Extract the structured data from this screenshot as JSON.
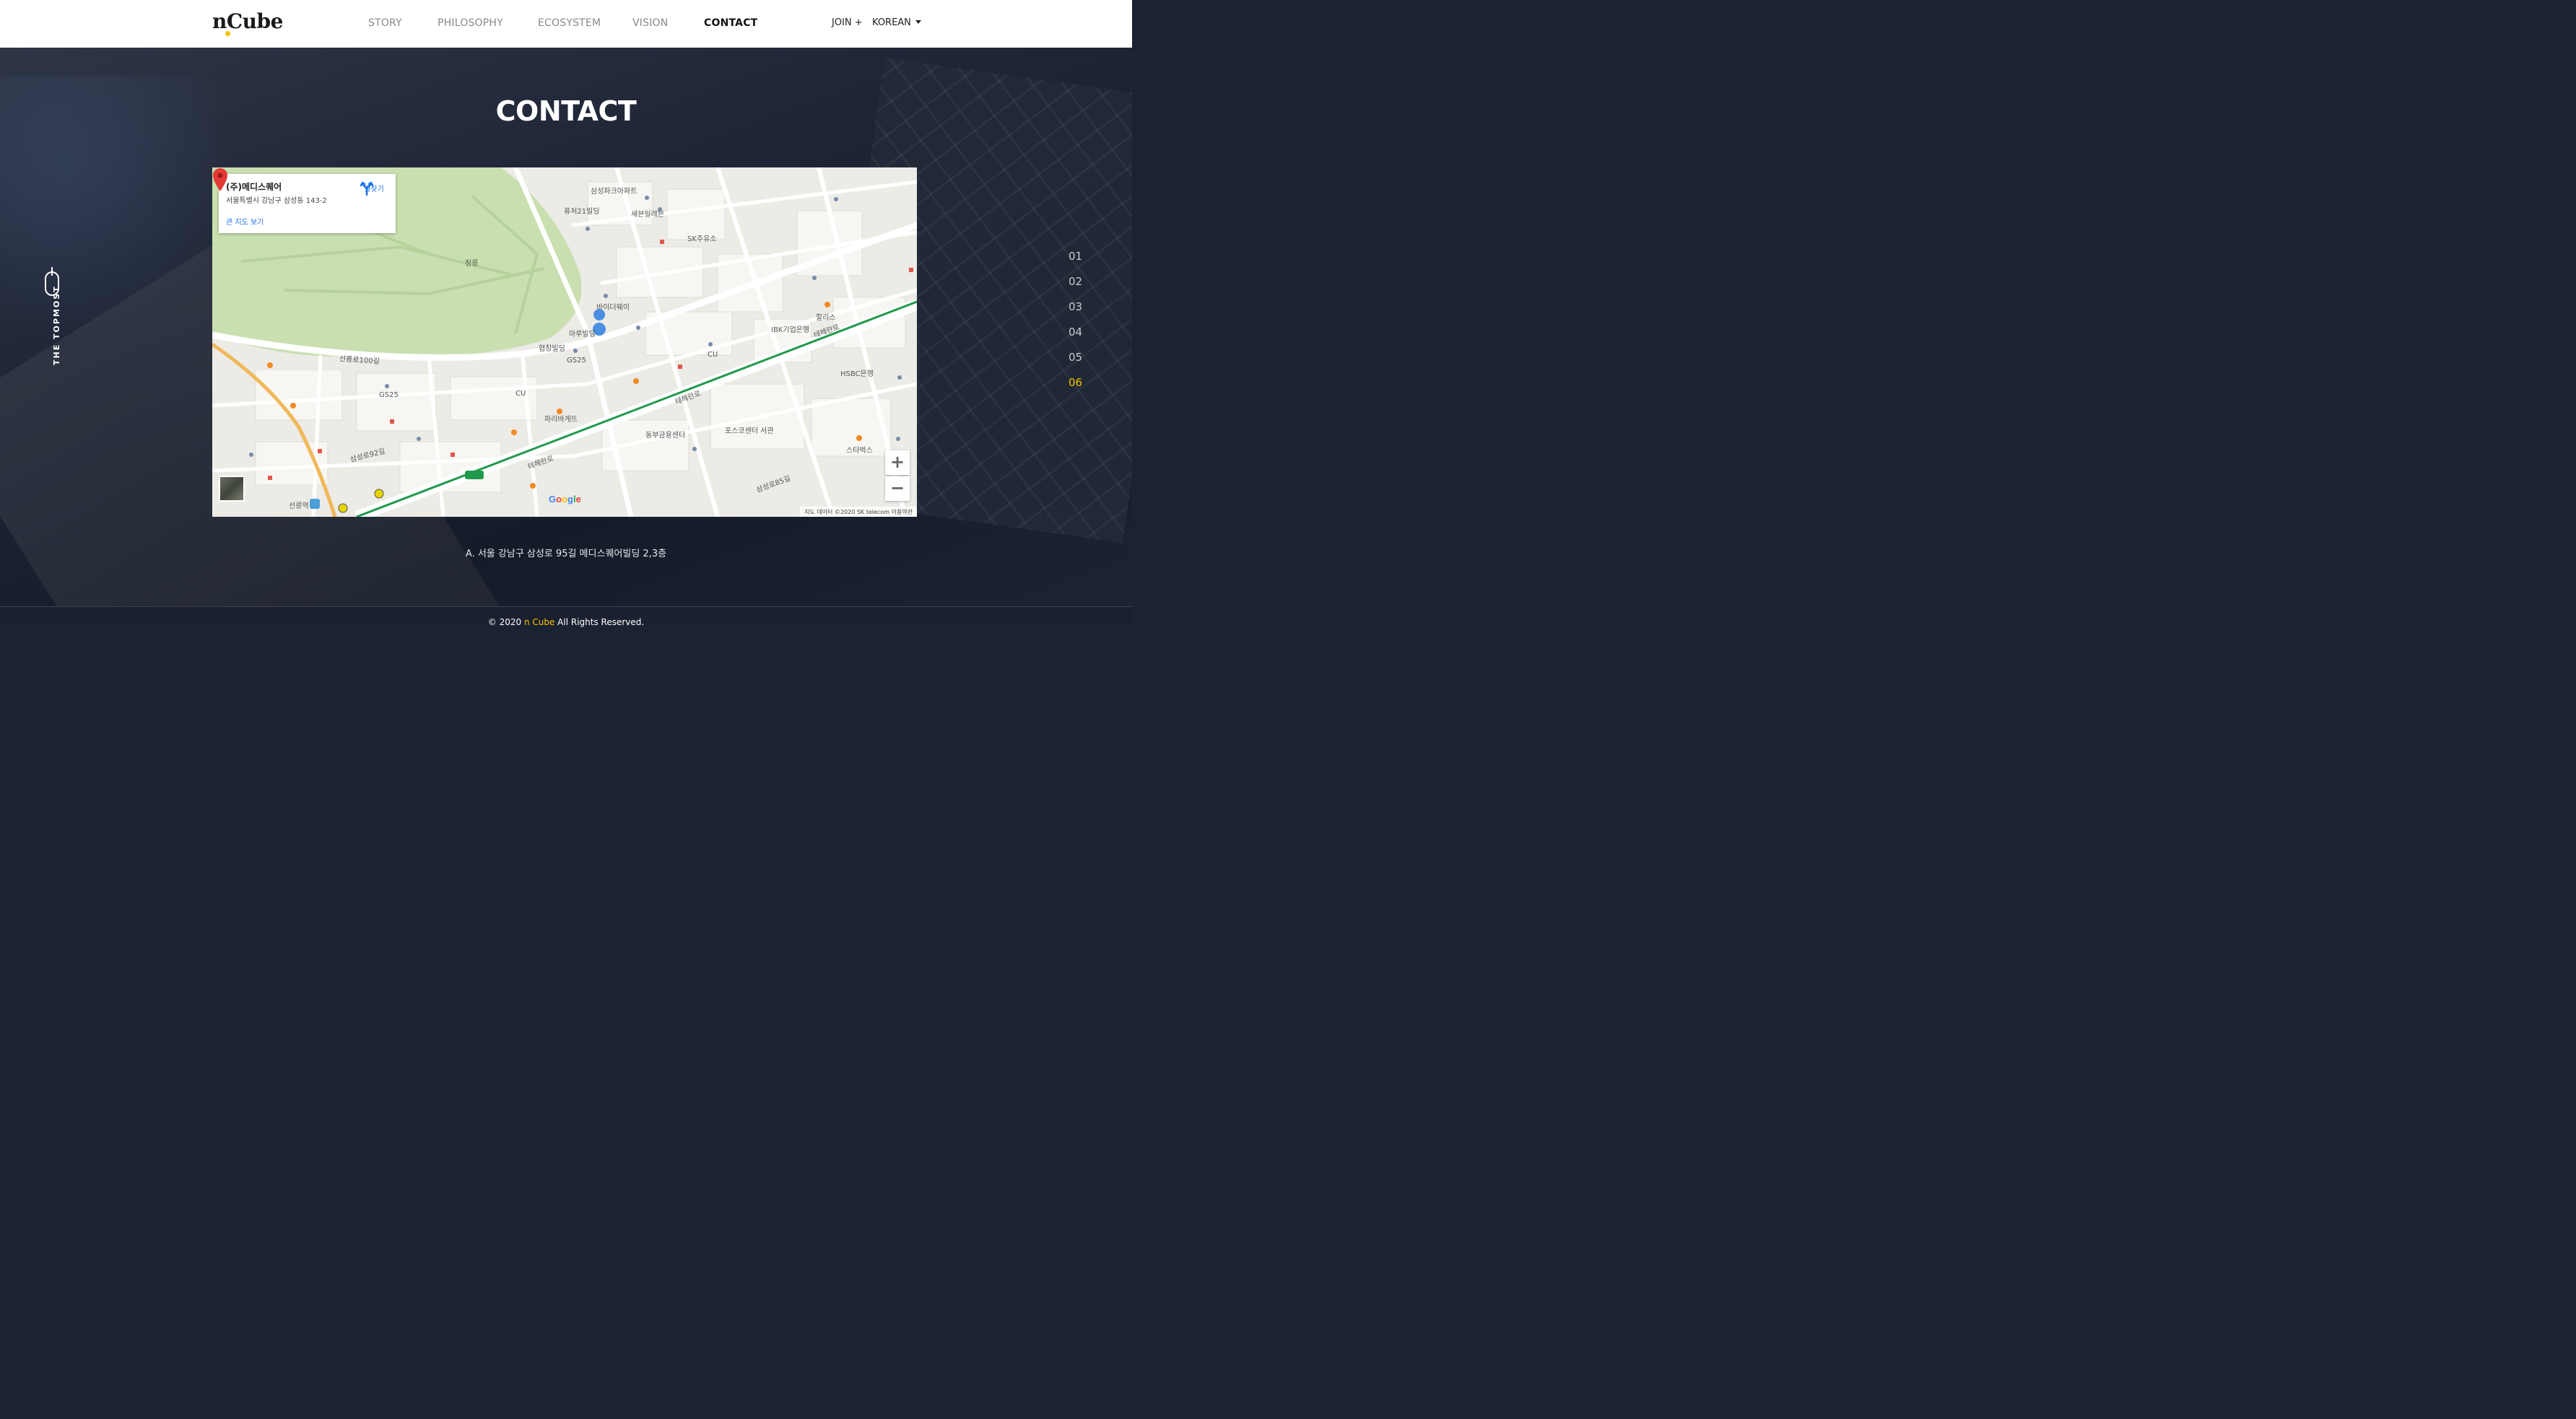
{
  "header": {
    "logo": "n Cube",
    "logo_left": "n",
    "logo_right": "Cube",
    "nav": [
      {
        "label": "STORY"
      },
      {
        "label": "PHILOSOPHY"
      },
      {
        "label": "ECOSYSTEM"
      },
      {
        "label": "VISION"
      },
      {
        "label": "CONTACT",
        "active": true
      }
    ],
    "join": "JOIN +",
    "language": "KOREAN"
  },
  "section": {
    "title": "CONTACT"
  },
  "side": {
    "topmost": "THE TOPMOST"
  },
  "pager": {
    "items": [
      "01",
      "02",
      "03",
      "04",
      "05",
      "06"
    ],
    "active": "06"
  },
  "map": {
    "info": {
      "name": "(주)메디스퀘어",
      "address": "서울특별시 강남구 삼성동 143-2",
      "directions": "길찾기",
      "larger_map": "큰 지도 보기"
    },
    "labels": {
      "jeongneung": "정릉",
      "samsung_park_apt": "삼성파크아파트",
      "future21": "퓨처21빌딩",
      "seven_eleven": "세븐일레븐",
      "sk_oil": "SK주유소",
      "harbor": "바이더웨이",
      "maru": "마루빌딩",
      "hyeopchang": "협창빌딩",
      "gs25": "GS25",
      "cu": "CU",
      "seolleung_100": "선릉로100길",
      "teheran": "테헤란로",
      "posco": "포스코센터 서관",
      "dongbu": "동부금융센터",
      "ibk": "IBK기업은행",
      "hsbc": "HSBC은행",
      "hollys": "할리스",
      "starbucks": "스타벅스",
      "seolleung_station": "선릉역",
      "paris": "파리바게뜨",
      "samsung_92": "삼성로92길",
      "samsung_85": "삼성로85길"
    },
    "google": "Google",
    "footer": "지도 데이터 ©2020 SK telecom    이용약관",
    "zoom_in": "+",
    "zoom_out": "−"
  },
  "address": "A. 서울 강남구 삼성로 95길 메디스퀘어빌딩 2,3층",
  "footer": {
    "prefix": "© 2020 ",
    "brand": "n Cube",
    "suffix": " All Rights Reserved."
  },
  "colors": {
    "accent": "#f5c400",
    "header_bg": "#ffffff",
    "hero_bg": "#1b2232",
    "map_pin": "#e53935",
    "link": "#1a73e8",
    "line2_green": "#1f9a4c"
  }
}
